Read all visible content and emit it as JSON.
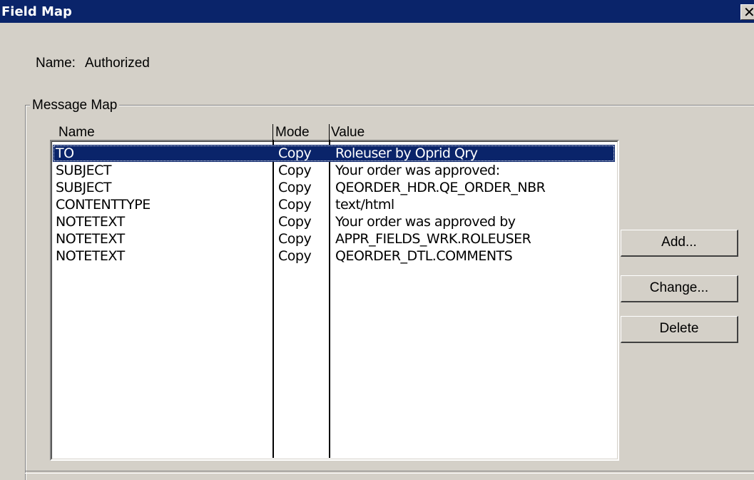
{
  "window": {
    "title": "Field Map",
    "close_glyph": "✕"
  },
  "name_field": {
    "label": "Name:",
    "value": "Authorized"
  },
  "message_map": {
    "group_label": "Message Map",
    "columns": [
      "Name",
      "Mode",
      "Value"
    ],
    "rows": [
      {
        "name": "TO",
        "mode": "Copy",
        "value": "Roleuser by Oprid Qry",
        "selected": true
      },
      {
        "name": "SUBJECT",
        "mode": "Copy",
        "value": "Your order was approved:"
      },
      {
        "name": "SUBJECT",
        "mode": "Copy",
        "value": "QEORDER_HDR.QE_ORDER_NBR"
      },
      {
        "name": "CONTENTTYPE",
        "mode": "Copy",
        "value": "text/html"
      },
      {
        "name": "NOTETEXT",
        "mode": "Copy",
        "value": "Your order was approved by"
      },
      {
        "name": "NOTETEXT",
        "mode": "Copy",
        "value": "APPR_FIELDS_WRK.ROLEUSER"
      },
      {
        "name": "NOTETEXT",
        "mode": "Copy",
        "value": "QEORDER_DTL.COMMENTS"
      }
    ]
  },
  "buttons": {
    "add": "Add...",
    "change": "Change...",
    "delete": "Delete"
  },
  "colors": {
    "title_bar": "#0a246a",
    "face": "#d4d0c8",
    "selection": "#0a246a"
  }
}
